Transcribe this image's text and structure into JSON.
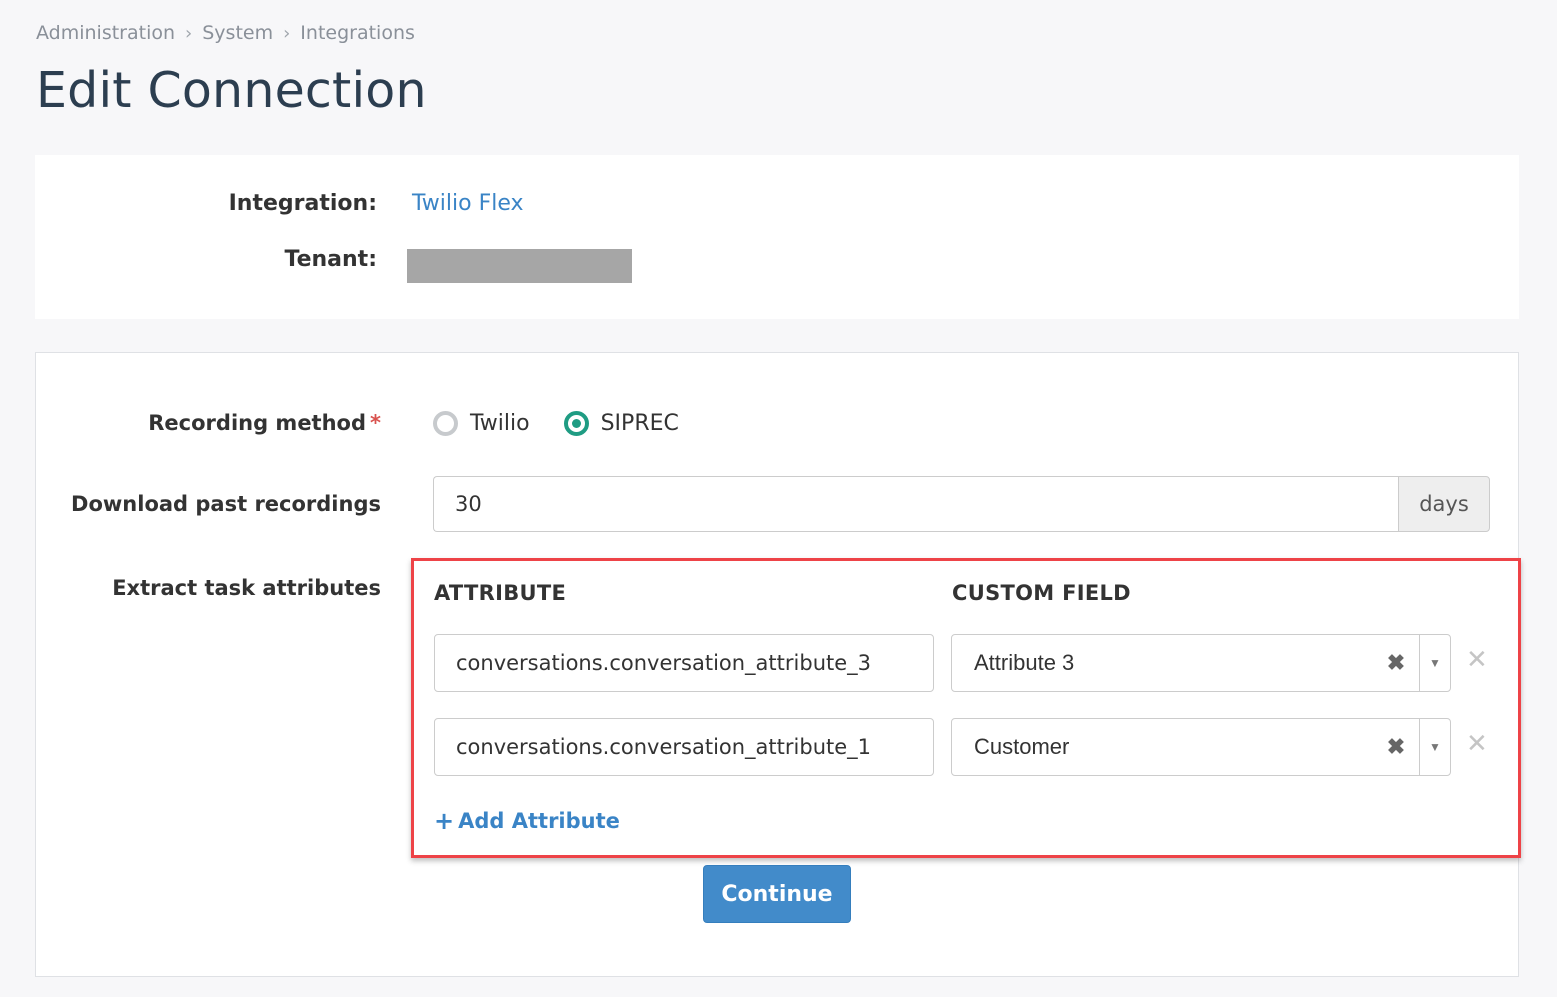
{
  "breadcrumb": {
    "items": [
      "Administration",
      "System",
      "Integrations"
    ],
    "separator": ">"
  },
  "page": {
    "title": "Edit Connection"
  },
  "info": {
    "integration_label": "Integration:",
    "integration_value": "Twilio Flex",
    "tenant_label": "Tenant:",
    "tenant_value": ""
  },
  "form": {
    "recording_method": {
      "label": "Recording method",
      "required_mark": "*",
      "options": [
        {
          "label": "Twilio",
          "checked": false
        },
        {
          "label": "SIPREC",
          "checked": true
        }
      ]
    },
    "download_past": {
      "label": "Download past recordings",
      "value": "30",
      "addon": "days"
    },
    "extract_attributes": {
      "label": "Extract task attributes",
      "col_attribute": "ATTRIBUTE",
      "col_custom_field": "CUSTOM FIELD",
      "rows": [
        {
          "attribute": "conversations.conversation_attribute_3",
          "custom_field": "Attribute 3"
        },
        {
          "attribute": "conversations.conversation_attribute_1",
          "custom_field": "Customer"
        }
      ],
      "add_label": "Add Attribute"
    },
    "continue_label": "Continue"
  },
  "icons": {
    "chevron": "›",
    "clear": "✖",
    "dropdown": "▼",
    "remove": "✕",
    "plus": "+"
  },
  "colors": {
    "accent": "#3a84c6",
    "primary_button": "#428bca",
    "radio_checked": "#1f9c83",
    "highlight_border": "#ee4347",
    "title": "#2c3e50"
  }
}
